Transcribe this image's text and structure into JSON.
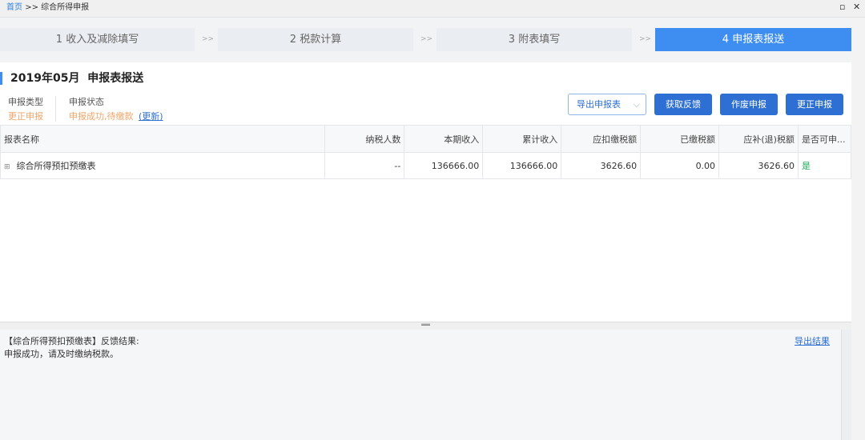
{
  "breadcrumb": {
    "home": "首页",
    "separator": ">>",
    "current": "综合所得申报"
  },
  "window": {
    "restore_icon": "restore-icon",
    "close_icon": "close-icon",
    "restore_glyph": "▫",
    "close_glyph": "✕"
  },
  "steps": [
    {
      "label": "1 收入及减除填写"
    },
    {
      "label": "2 税款计算"
    },
    {
      "label": "3 附表填写"
    },
    {
      "label": "4 申报表报送",
      "active": true
    }
  ],
  "step_separator": ">>",
  "page": {
    "title": "2019年05月  申报表报送",
    "type_label": "申报类型",
    "type_value": "更正申报",
    "status_label": "申报状态",
    "status_value": "申报成功,待缴款",
    "refresh_link": "(更新)"
  },
  "actions": {
    "export_dropdown": "导出申报表",
    "get_feedback": "获取反馈",
    "void": "作废申报",
    "correct": "更正申报"
  },
  "table": {
    "headers": [
      "报表名称",
      "纳税人数",
      "本期收入",
      "累计收入",
      "应扣缴税额",
      "已缴税额",
      "应补(退)税额",
      "是否可申..."
    ],
    "rows": [
      [
        "综合所得预扣预缴表",
        "--",
        "136666.00",
        "136666.00",
        "3626.60",
        "0.00",
        "3626.60",
        "是"
      ]
    ]
  },
  "feedback": {
    "line1": "【综合所得预扣预缴表】反馈结果:",
    "line2": "申报成功，请及时缴纳税款。",
    "export_link": "导出结果"
  },
  "colors": {
    "accent": "#3d8ef0",
    "button": "#2e6fd3",
    "orange": "#f0a56a",
    "green": "#1aaa55"
  }
}
